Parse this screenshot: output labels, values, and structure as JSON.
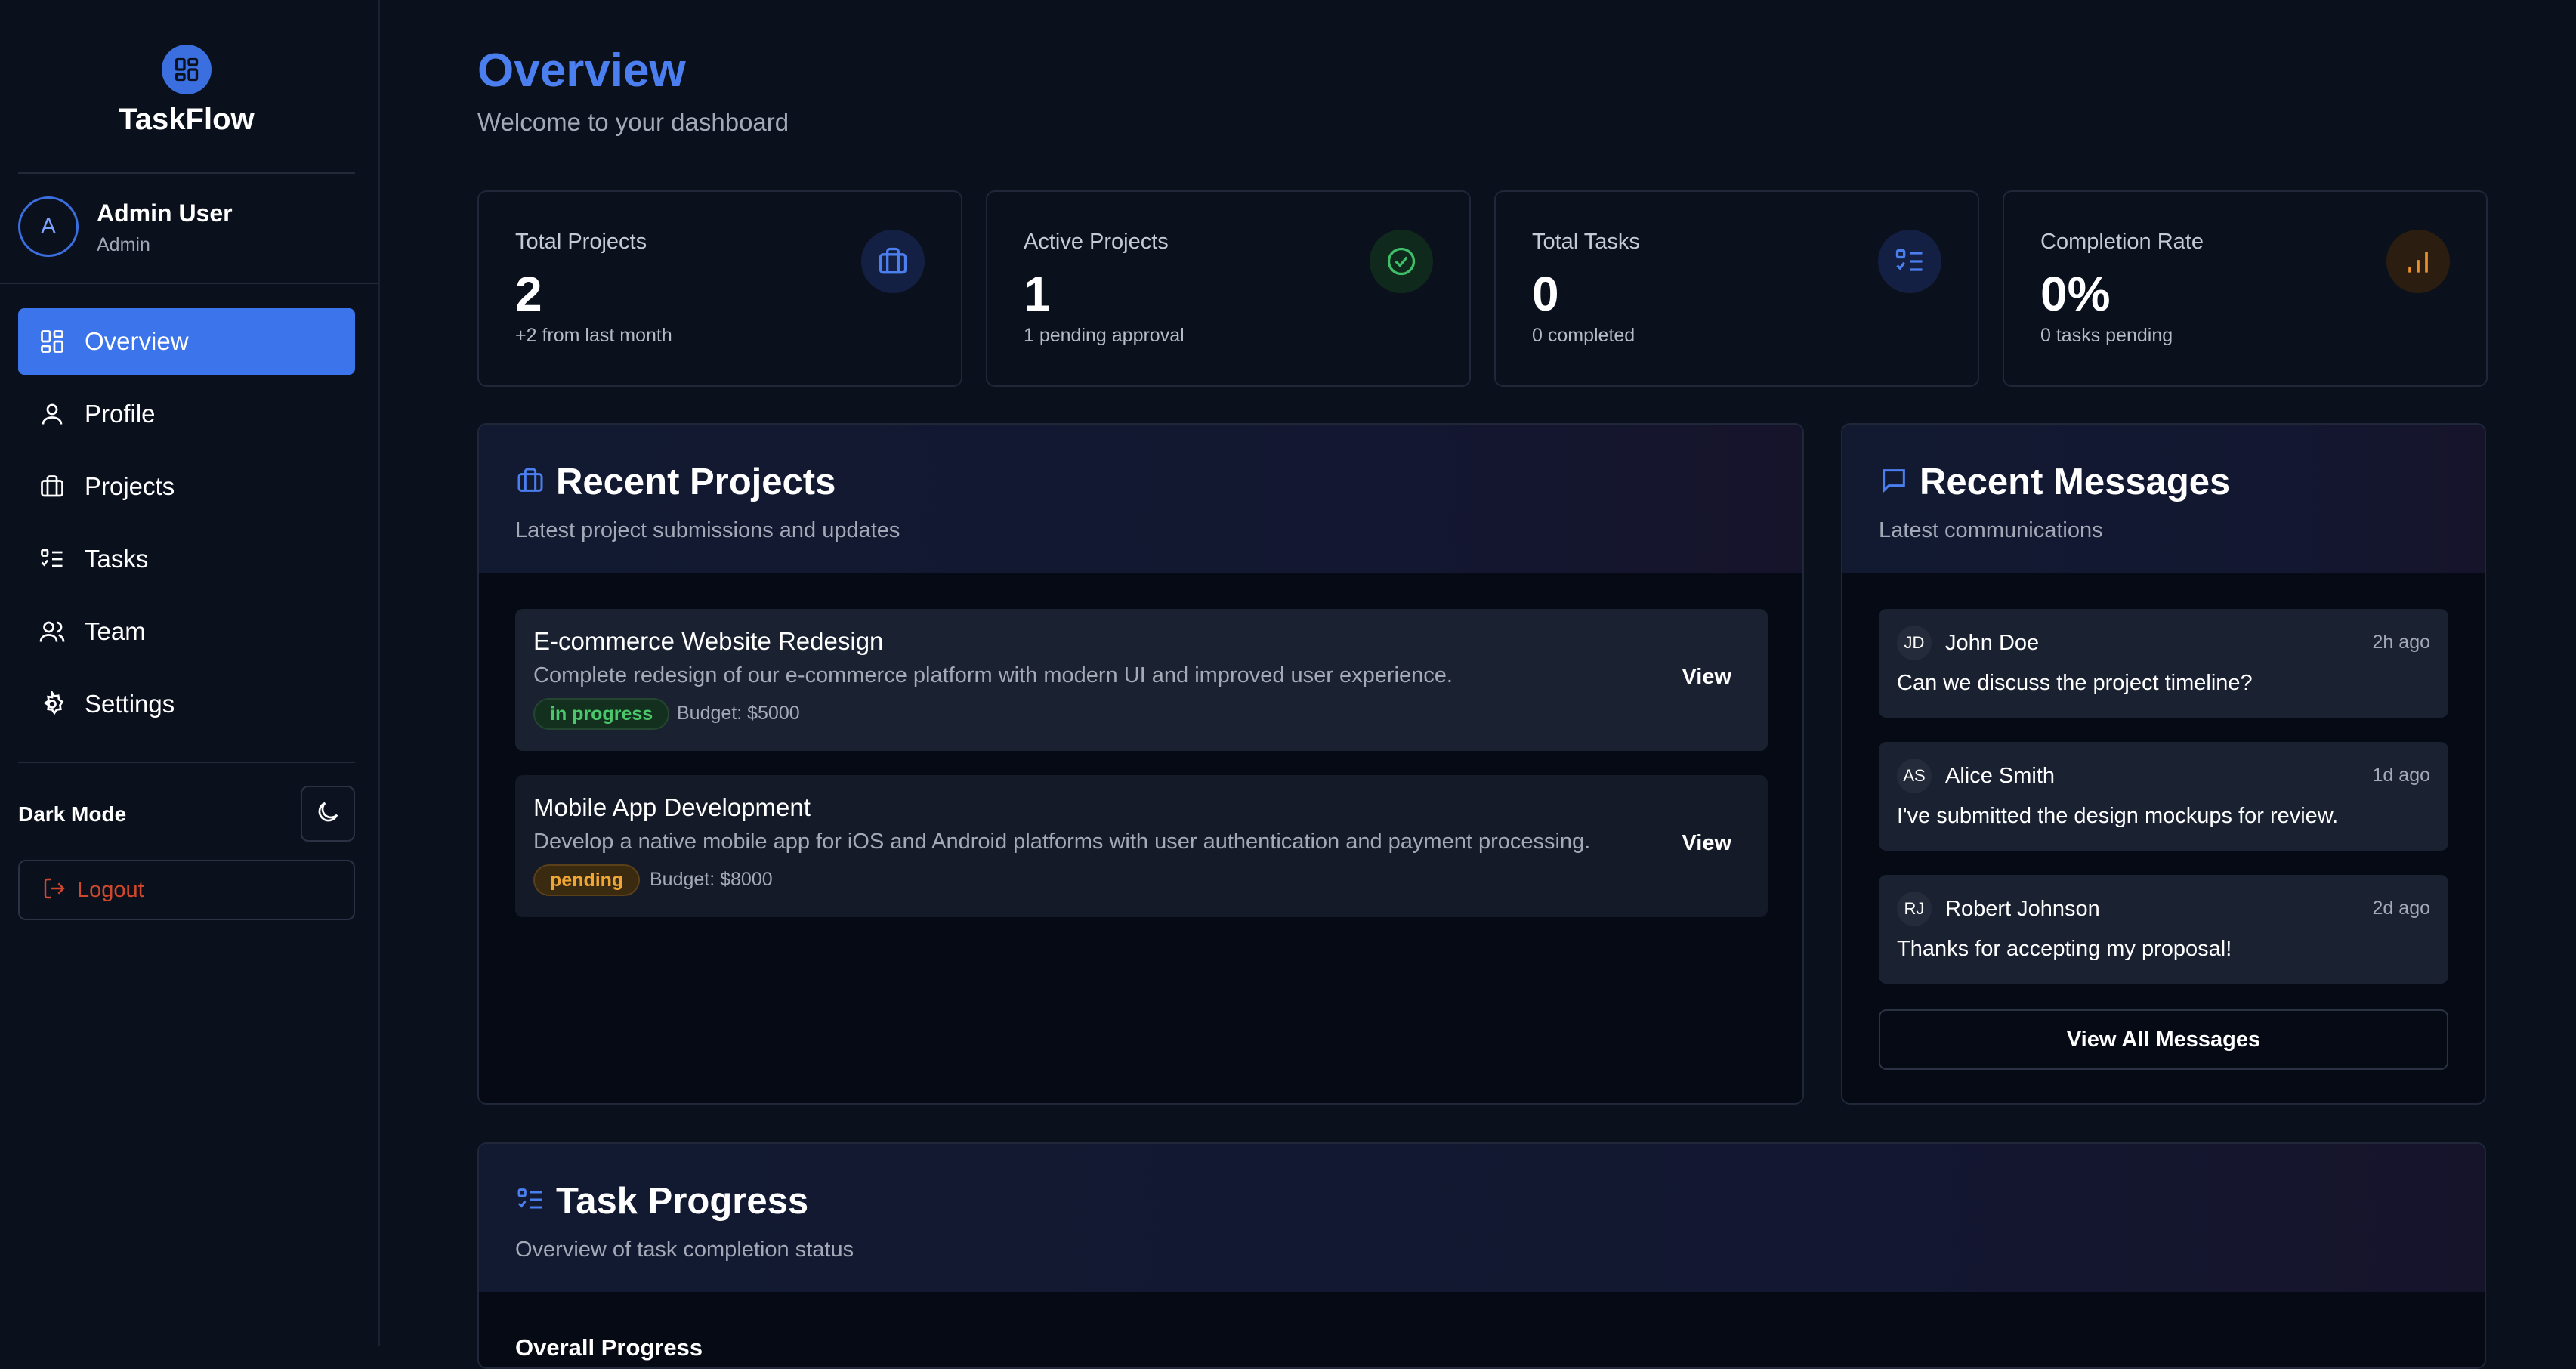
{
  "brand": {
    "title": "TaskFlow",
    "icon": "dashboard-grid-icon"
  },
  "user": {
    "initial": "A",
    "name": "Admin User",
    "role": "Admin"
  },
  "nav": {
    "items": [
      {
        "label": "Overview",
        "icon": "dashboard-grid-icon",
        "active": true
      },
      {
        "label": "Profile",
        "icon": "user-icon"
      },
      {
        "label": "Projects",
        "icon": "briefcase-icon"
      },
      {
        "label": "Tasks",
        "icon": "checklist-icon"
      },
      {
        "label": "Team",
        "icon": "users-icon"
      },
      {
        "label": "Settings",
        "icon": "gear-icon"
      }
    ]
  },
  "dark_mode": {
    "label": "Dark Mode",
    "icon": "moon-icon"
  },
  "logout": {
    "label": "Logout",
    "icon": "logout-icon"
  },
  "header": {
    "title": "Overview",
    "subtitle": "Welcome to your dashboard"
  },
  "stats": [
    {
      "label": "Total Projects",
      "value": "2",
      "sub": "+2 from last month",
      "icon": "briefcase-icon",
      "color": "#4b7ff0"
    },
    {
      "label": "Active Projects",
      "value": "1",
      "sub": "1 pending approval",
      "icon": "check-circle-icon",
      "color": "#3fbf6a"
    },
    {
      "label": "Total Tasks",
      "value": "0",
      "sub": "0 completed",
      "icon": "checklist-icon",
      "color": "#4b7ff0"
    },
    {
      "label": "Completion Rate",
      "value": "0%",
      "sub": "0 tasks pending",
      "icon": "bar-chart-icon",
      "color": "#e8902a"
    }
  ],
  "recent_projects": {
    "title": "Recent Projects",
    "subtitle": "Latest project submissions and updates",
    "items": [
      {
        "title": "E-commerce Website Redesign",
        "description": "Complete redesign of our e-commerce platform with modern UI and improved user experience.",
        "status": "in progress",
        "budget": "Budget: $5000",
        "view_label": "View"
      },
      {
        "title": "Mobile App Development",
        "description": "Develop a native mobile app for iOS and Android platforms with user authentication and payment processing.",
        "status": "pending",
        "budget": "Budget: $8000",
        "view_label": "View"
      }
    ]
  },
  "recent_messages": {
    "title": "Recent Messages",
    "subtitle": "Latest communications",
    "items": [
      {
        "initials": "JD",
        "name": "John Doe",
        "time": "2h ago",
        "text": "Can we discuss the project timeline?"
      },
      {
        "initials": "AS",
        "name": "Alice Smith",
        "time": "1d ago",
        "text": "I've submitted the design mockups for review."
      },
      {
        "initials": "RJ",
        "name": "Robert Johnson",
        "time": "2d ago",
        "text": "Thanks for accepting my proposal!"
      }
    ],
    "view_all_label": "View All Messages"
  },
  "task_progress": {
    "title": "Task Progress",
    "subtitle": "Overview of task completion status",
    "overall_label": "Overall Progress"
  }
}
